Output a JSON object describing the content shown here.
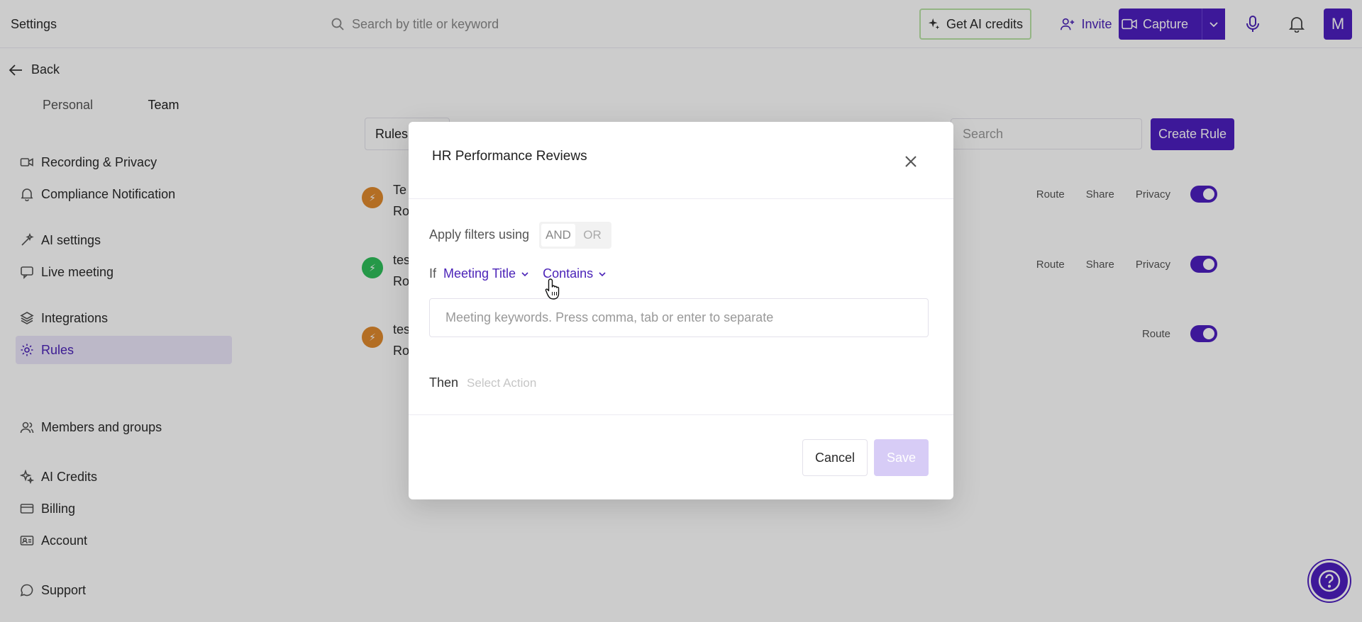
{
  "topbar": {
    "title": "Settings",
    "search_placeholder": "Search by title or keyword",
    "credits_label": "Get AI credits",
    "invite_label": "Invite",
    "capture_label": "Capture",
    "avatar_letter": "M"
  },
  "sidebar": {
    "back_label": "Back",
    "tabs": [
      "Personal",
      "Team"
    ],
    "items": [
      {
        "label": "Recording & Privacy",
        "icon": "video-icon"
      },
      {
        "label": "Compliance Notification",
        "icon": "bell-icon"
      },
      {
        "label": "AI settings",
        "icon": "magic-wand-icon"
      },
      {
        "label": "Live meeting",
        "icon": "message-icon"
      },
      {
        "label": "Integrations",
        "icon": "layers-icon"
      },
      {
        "label": "Rules",
        "icon": "gear-icon"
      },
      {
        "label": "Members and groups",
        "icon": "users-icon"
      },
      {
        "label": "AI Credits",
        "icon": "sparkle-icon"
      },
      {
        "label": "Billing",
        "icon": "card-icon"
      },
      {
        "label": "Account",
        "icon": "id-card-icon"
      },
      {
        "label": "Support",
        "icon": "chat-icon"
      }
    ]
  },
  "main": {
    "rules_tab": "Rules",
    "search_placeholder": "Search",
    "create_rule_label": "Create Rule",
    "rows": [
      {
        "name": "Te",
        "sub": "Ro",
        "tags": [
          "Route",
          "Share",
          "Privacy"
        ],
        "dot_color": "#e08a2e"
      },
      {
        "name": "tes",
        "sub": "Ro",
        "tags": [
          "Route",
          "Share",
          "Privacy"
        ],
        "dot_color": "#2fbf5a"
      },
      {
        "name": "tes",
        "sub": "Ro",
        "tags": [
          "Route"
        ],
        "dot_color": "#e08a2e"
      }
    ]
  },
  "modal": {
    "title": "HR Performance Reviews",
    "apply_label": "Apply filters using",
    "and_label": "AND",
    "or_label": "OR",
    "if_label": "If",
    "field_label": "Meeting Title",
    "operator_label": "Contains",
    "keywords_placeholder": "Meeting keywords. Press comma, tab or enter to separate",
    "then_label": "Then",
    "action_placeholder": "Select Action",
    "cancel_label": "Cancel",
    "save_label": "Save"
  },
  "colors": {
    "brand": "#4d1fc0",
    "accent_text": "#4b23b8",
    "save_disabled": "#d7ccf6"
  }
}
